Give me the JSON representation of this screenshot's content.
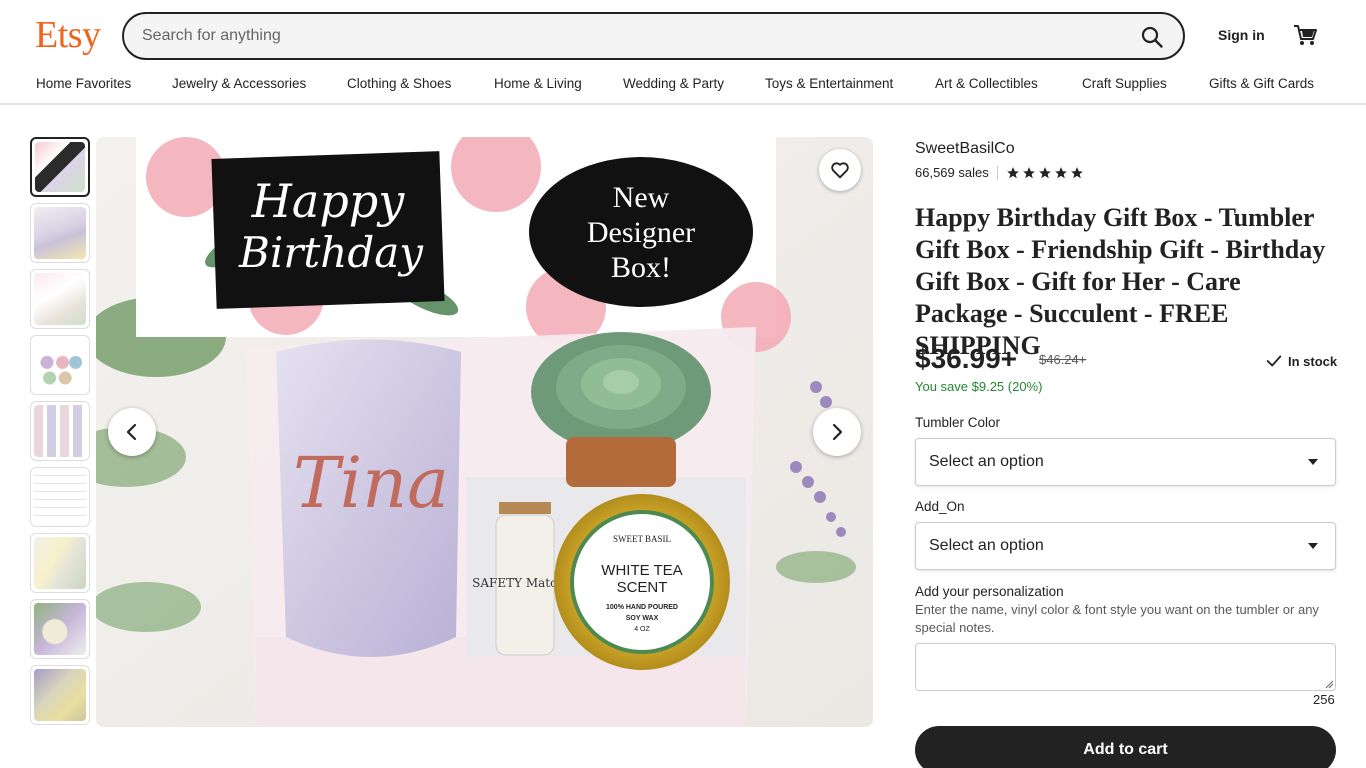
{
  "header": {
    "logo": "Etsy",
    "search_placeholder": "Search for anything",
    "signin_label": "Sign in",
    "cart_icon": "cart-icon",
    "search_icon": "search-icon"
  },
  "nav": {
    "items": [
      "Home Favorites",
      "Jewelry & Accessories",
      "Clothing & Shoes",
      "Home & Living",
      "Wedding & Party",
      "Toys & Entertainment",
      "Art & Collectibles",
      "Craft Supplies",
      "Gifts & Gift Cards"
    ]
  },
  "gallery": {
    "thumbnail_count": 9,
    "selected_index": 0,
    "main_image": {
      "card_text_line1": "Happy",
      "card_text_line2": "Birthday",
      "badge_line1": "New",
      "badge_line2": "Designer",
      "badge_line3": "Box!",
      "tumbler_name": "Tina",
      "matches_label": "SAFETY Matches",
      "candle_brand": "SWEET BASIL",
      "candle_line1": "WHITE TEA",
      "candle_line2": "SCENT",
      "candle_line3": "100% HAND POURED",
      "candle_line4": "SOY WAX",
      "candle_line5": "4 OZ"
    },
    "prev_icon": "chevron-left-icon",
    "next_icon": "chevron-right-icon",
    "favorite_icon": "heart-icon"
  },
  "listing": {
    "shop_name": "SweetBasilCo",
    "sales": "66,569 sales",
    "rating_stars": 5,
    "title": "Happy Birthday Gift Box - Tumbler Gift Box - Friendship Gift - Birthday Gift Box - Gift for Her - Care Package - Succulent - FREE SHIPPING",
    "price": "$36.99+",
    "old_price": "$46.24+",
    "stock": "In stock",
    "savings": "You save $9.25 (20%)",
    "tumbler_color_label": "Tumbler Color",
    "tumbler_color_value": "Select an option",
    "addon_label": "Add_On",
    "addon_value": "Select an option",
    "personalization_label": "Add your personalization",
    "personalization_help": "Enter the name, vinyl color & font style you want on the tumbler or any special notes.",
    "char_count": "256",
    "add_to_cart_label": "Add to cart"
  },
  "colors": {
    "brand": "#F1641E",
    "save_green": "#258635",
    "button_dark": "#222222"
  }
}
